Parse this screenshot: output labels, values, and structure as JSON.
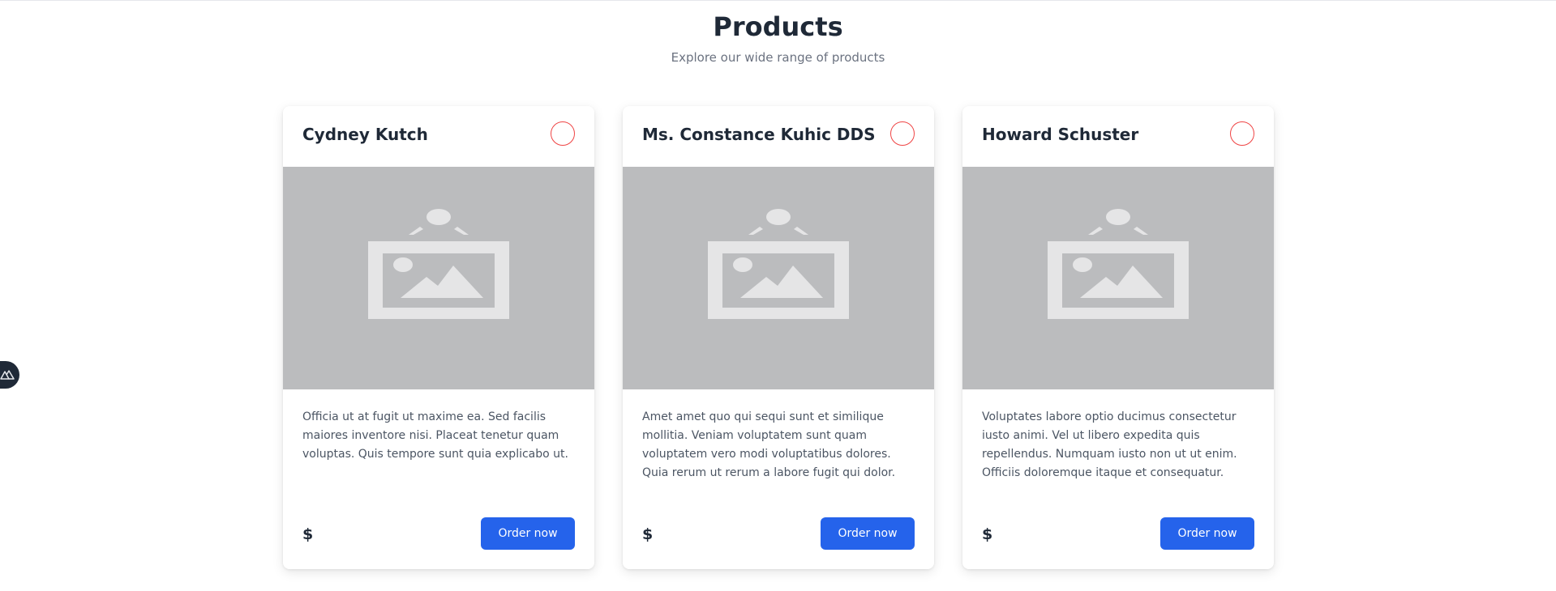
{
  "page": {
    "title": "Products",
    "subtitle": "Explore our wide range of products"
  },
  "products": [
    {
      "name": "Cydney Kutch",
      "description": "Officia ut at fugit ut maxime ea. Sed facilis maiores inventore nisi. Placeat tenetur quam voluptas. Quis tempore sunt quia explicabo ut.",
      "price_label": "$",
      "order_label": "Order now",
      "image_icon": "image-placeholder-icon",
      "favorite_icon": "favorite-circle-icon"
    },
    {
      "name": "Ms. Constance Kuhic DDS",
      "description": "Amet amet quo qui sequi sunt et similique mollitia. Veniam voluptatem sunt quam voluptatem vero modi voluptatibus dolores. Quia rerum ut rerum a labore fugit qui dolor.",
      "price_label": "$",
      "order_label": "Order now",
      "image_icon": "image-placeholder-icon",
      "favorite_icon": "favorite-circle-icon"
    },
    {
      "name": "Howard Schuster",
      "description": "Voluptates labore optio ducimus consectetur iusto animi. Vel ut libero expedita quis repellendus. Numquam iusto non ut ut enim. Officiis doloremque itaque et consequatur.",
      "price_label": "$",
      "order_label": "Order now",
      "image_icon": "image-placeholder-icon",
      "favorite_icon": "favorite-circle-icon"
    }
  ],
  "colors": {
    "accent": "#2563eb",
    "favorite_border": "#ef4444",
    "image_bg": "#bbbcbe"
  },
  "widgets": {
    "side_toggle_icon": "nuxt-devtools-icon"
  }
}
